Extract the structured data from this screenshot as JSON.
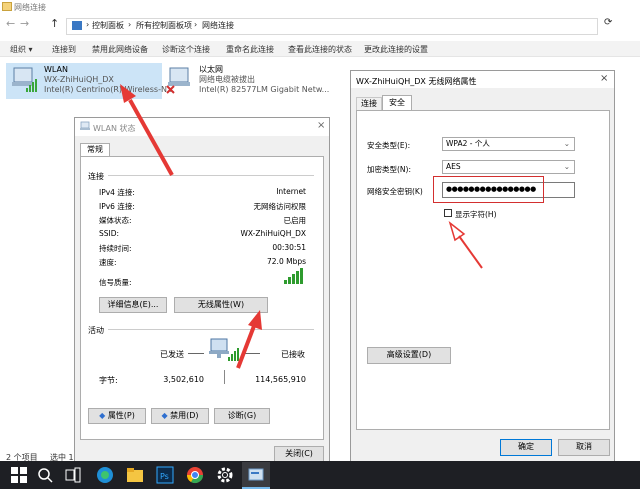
{
  "window": {
    "title": "网络连接"
  },
  "nav": {
    "back": "←",
    "forward": "→",
    "up": "↑",
    "refresh": "⟳"
  },
  "breadcrumb": {
    "items": [
      "控制面板",
      "所有控制面板项",
      "网络连接"
    ],
    "sep": "›"
  },
  "cmdbar": {
    "organize": "组织 ▾",
    "items": [
      "连接到",
      "禁用此网络设备",
      "诊断这个连接",
      "重命名此连接",
      "查看此连接的状态",
      "更改此连接的设置"
    ]
  },
  "items": {
    "wlan": {
      "name": "WLAN",
      "ssid": "WX-ZhiHuiQH_DX",
      "adapter": "Intel(R) Centrino(R) Wireless-N..."
    },
    "ethernet": {
      "name": "以太网",
      "status": "网络电缆被拔出",
      "adapter": "Intel(R) 82577LM Gigabit Netw..."
    }
  },
  "statusbar": {
    "count": "2 个项目",
    "selected": "选中 1"
  },
  "wlan_status": {
    "title": "WLAN 状态",
    "tab": "常规",
    "section_connection": "连接",
    "rows": [
      {
        "label": "IPv4 连接:",
        "value": "Internet"
      },
      {
        "label": "IPv6 连接:",
        "value": "无网络访问权限"
      },
      {
        "label": "媒体状态:",
        "value": "已启用"
      },
      {
        "label": "SSID:",
        "value": "WX-ZhiHuiQH_DX"
      },
      {
        "label": "持续时间:",
        "value": "00:30:51"
      },
      {
        "label": "速度:",
        "value": "72.0 Mbps"
      }
    ],
    "signal_label": "信号质量:",
    "details_btn": "详细信息(E)...",
    "wireless_props_btn": "无线属性(W)",
    "section_activity": "活动",
    "sent_label": "已发送",
    "received_label": "已接收",
    "bytes_label": "字节:",
    "bytes_sent": "3,502,610",
    "bytes_received": "114,565,910",
    "properties_btn": "属性(P)",
    "disable_btn": "禁用(D)",
    "diagnose_btn": "诊断(G)",
    "close_btn": "关闭(C)",
    "close_x": "×"
  },
  "wireless_props": {
    "title": "WX-ZhiHuiQH_DX 无线网络属性",
    "close_x": "×",
    "tabs": [
      "连接",
      "安全"
    ],
    "security_type_label": "安全类型(E):",
    "security_type_value": "WPA2 - 个人",
    "encryption_type_label": "加密类型(N):",
    "encryption_type_value": "AES",
    "key_label": "网络安全密钥(K)",
    "key_value": "●●●●●●●●●●●●●●●●",
    "show_chars_label": "显示字符(H)",
    "advanced_btn": "高级设置(D)",
    "ok_btn": "确定",
    "cancel_btn": "取消"
  },
  "colors": {
    "accent": "#0078d7",
    "arrow": "#e53935",
    "highlight": "#cce4f7",
    "taskbar": "#1e1f24"
  }
}
